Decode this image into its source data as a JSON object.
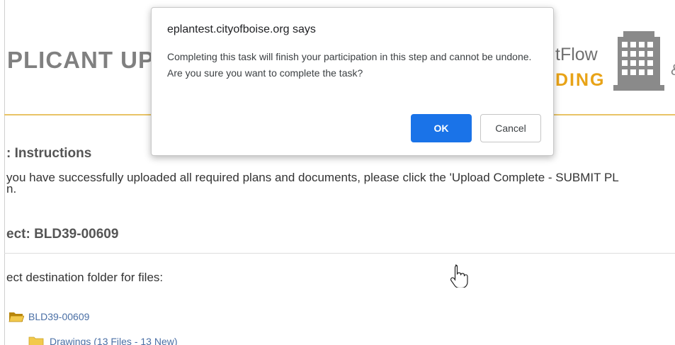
{
  "header": {
    "title": "PLICANT UP",
    "brand_line1": "tFlow",
    "brand_line2": "DING",
    "edge_char": "&"
  },
  "instructions": {
    "heading": ": Instructions",
    "line1": "you have successfully uploaded all required plans and documents, please click the 'Upload Complete - SUBMIT PL",
    "line2": "n."
  },
  "project": {
    "heading": "ect: BLD39-00609"
  },
  "folders": {
    "prompt": "ect destination folder for files:",
    "root_label": "BLD39-00609",
    "child_label": "Drawings (13 Files - 13 New)"
  },
  "dialog": {
    "title": "eplantest.cityofboise.org says",
    "message": "Completing this task will finish your participation in this step and cannot be undone. Are you sure you want to complete the task?",
    "ok_label": "OK",
    "cancel_label": "Cancel"
  },
  "icons": {
    "building": "building-icon",
    "folder": "folder-icon",
    "open_folder": "open-folder-icon",
    "cursor": "hand-pointer-cursor-icon"
  },
  "colors": {
    "accent": "#1a73e8",
    "brand_gold": "#e8a317",
    "header_gray": "#808080",
    "link_blue": "#4a6fa5"
  }
}
